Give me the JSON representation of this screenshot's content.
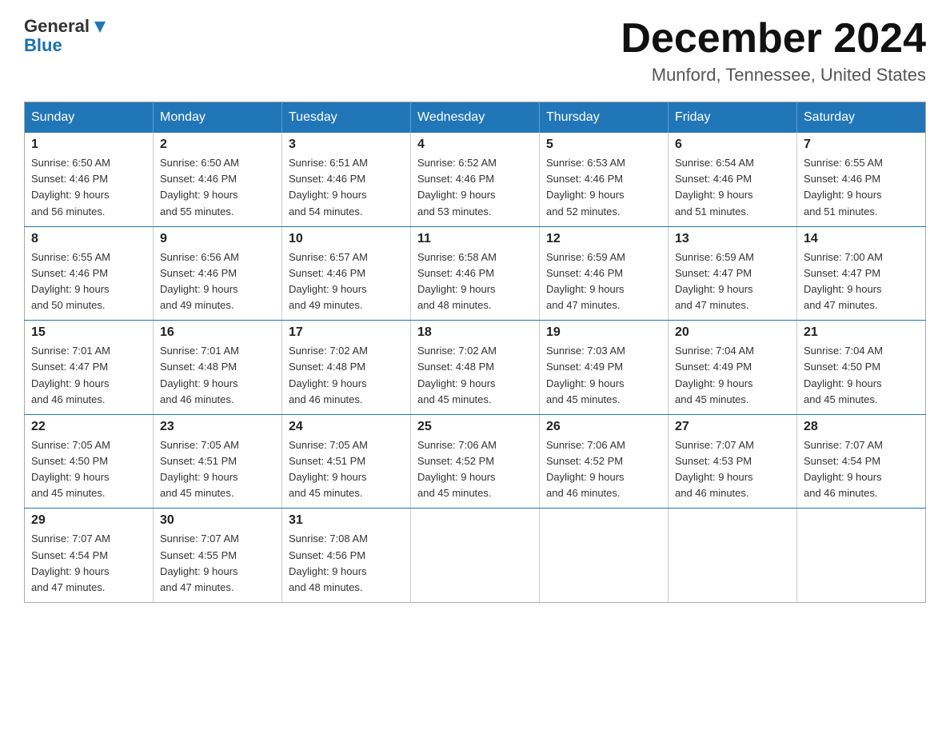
{
  "header": {
    "logo_general": "General",
    "logo_blue": "Blue",
    "month_title": "December 2024",
    "location": "Munford, Tennessee, United States"
  },
  "days_of_week": [
    "Sunday",
    "Monday",
    "Tuesday",
    "Wednesday",
    "Thursday",
    "Friday",
    "Saturday"
  ],
  "weeks": [
    [
      {
        "day": "1",
        "sunrise": "6:50 AM",
        "sunset": "4:46 PM",
        "daylight": "9 hours and 56 minutes."
      },
      {
        "day": "2",
        "sunrise": "6:50 AM",
        "sunset": "4:46 PM",
        "daylight": "9 hours and 55 minutes."
      },
      {
        "day": "3",
        "sunrise": "6:51 AM",
        "sunset": "4:46 PM",
        "daylight": "9 hours and 54 minutes."
      },
      {
        "day": "4",
        "sunrise": "6:52 AM",
        "sunset": "4:46 PM",
        "daylight": "9 hours and 53 minutes."
      },
      {
        "day": "5",
        "sunrise": "6:53 AM",
        "sunset": "4:46 PM",
        "daylight": "9 hours and 52 minutes."
      },
      {
        "day": "6",
        "sunrise": "6:54 AM",
        "sunset": "4:46 PM",
        "daylight": "9 hours and 51 minutes."
      },
      {
        "day": "7",
        "sunrise": "6:55 AM",
        "sunset": "4:46 PM",
        "daylight": "9 hours and 51 minutes."
      }
    ],
    [
      {
        "day": "8",
        "sunrise": "6:55 AM",
        "sunset": "4:46 PM",
        "daylight": "9 hours and 50 minutes."
      },
      {
        "day": "9",
        "sunrise": "6:56 AM",
        "sunset": "4:46 PM",
        "daylight": "9 hours and 49 minutes."
      },
      {
        "day": "10",
        "sunrise": "6:57 AM",
        "sunset": "4:46 PM",
        "daylight": "9 hours and 49 minutes."
      },
      {
        "day": "11",
        "sunrise": "6:58 AM",
        "sunset": "4:46 PM",
        "daylight": "9 hours and 48 minutes."
      },
      {
        "day": "12",
        "sunrise": "6:59 AM",
        "sunset": "4:46 PM",
        "daylight": "9 hours and 47 minutes."
      },
      {
        "day": "13",
        "sunrise": "6:59 AM",
        "sunset": "4:47 PM",
        "daylight": "9 hours and 47 minutes."
      },
      {
        "day": "14",
        "sunrise": "7:00 AM",
        "sunset": "4:47 PM",
        "daylight": "9 hours and 47 minutes."
      }
    ],
    [
      {
        "day": "15",
        "sunrise": "7:01 AM",
        "sunset": "4:47 PM",
        "daylight": "9 hours and 46 minutes."
      },
      {
        "day": "16",
        "sunrise": "7:01 AM",
        "sunset": "4:48 PM",
        "daylight": "9 hours and 46 minutes."
      },
      {
        "day": "17",
        "sunrise": "7:02 AM",
        "sunset": "4:48 PM",
        "daylight": "9 hours and 46 minutes."
      },
      {
        "day": "18",
        "sunrise": "7:02 AM",
        "sunset": "4:48 PM",
        "daylight": "9 hours and 45 minutes."
      },
      {
        "day": "19",
        "sunrise": "7:03 AM",
        "sunset": "4:49 PM",
        "daylight": "9 hours and 45 minutes."
      },
      {
        "day": "20",
        "sunrise": "7:04 AM",
        "sunset": "4:49 PM",
        "daylight": "9 hours and 45 minutes."
      },
      {
        "day": "21",
        "sunrise": "7:04 AM",
        "sunset": "4:50 PM",
        "daylight": "9 hours and 45 minutes."
      }
    ],
    [
      {
        "day": "22",
        "sunrise": "7:05 AM",
        "sunset": "4:50 PM",
        "daylight": "9 hours and 45 minutes."
      },
      {
        "day": "23",
        "sunrise": "7:05 AM",
        "sunset": "4:51 PM",
        "daylight": "9 hours and 45 minutes."
      },
      {
        "day": "24",
        "sunrise": "7:05 AM",
        "sunset": "4:51 PM",
        "daylight": "9 hours and 45 minutes."
      },
      {
        "day": "25",
        "sunrise": "7:06 AM",
        "sunset": "4:52 PM",
        "daylight": "9 hours and 45 minutes."
      },
      {
        "day": "26",
        "sunrise": "7:06 AM",
        "sunset": "4:52 PM",
        "daylight": "9 hours and 46 minutes."
      },
      {
        "day": "27",
        "sunrise": "7:07 AM",
        "sunset": "4:53 PM",
        "daylight": "9 hours and 46 minutes."
      },
      {
        "day": "28",
        "sunrise": "7:07 AM",
        "sunset": "4:54 PM",
        "daylight": "9 hours and 46 minutes."
      }
    ],
    [
      {
        "day": "29",
        "sunrise": "7:07 AM",
        "sunset": "4:54 PM",
        "daylight": "9 hours and 47 minutes."
      },
      {
        "day": "30",
        "sunrise": "7:07 AM",
        "sunset": "4:55 PM",
        "daylight": "9 hours and 47 minutes."
      },
      {
        "day": "31",
        "sunrise": "7:08 AM",
        "sunset": "4:56 PM",
        "daylight": "9 hours and 48 minutes."
      },
      null,
      null,
      null,
      null
    ]
  ],
  "labels": {
    "sunrise": "Sunrise:",
    "sunset": "Sunset:",
    "daylight": "Daylight:"
  }
}
